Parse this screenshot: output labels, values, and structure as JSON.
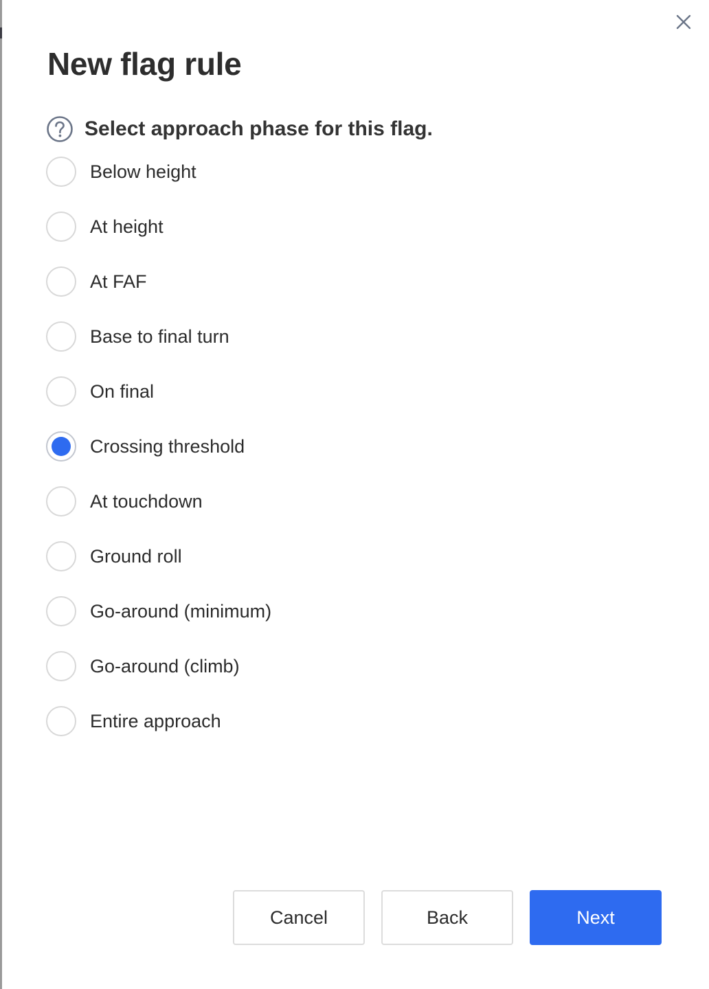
{
  "dialog": {
    "title": "New flag rule",
    "question": "Select approach phase for this flag.",
    "close_icon": "close-icon",
    "help_icon": "question-circle-icon"
  },
  "options": [
    {
      "label": "Below height",
      "checked": false
    },
    {
      "label": "At height",
      "checked": false
    },
    {
      "label": "At FAF",
      "checked": false
    },
    {
      "label": "Base to final turn",
      "checked": false
    },
    {
      "label": "On final",
      "checked": false
    },
    {
      "label": "Crossing threshold",
      "checked": true
    },
    {
      "label": "At touchdown",
      "checked": false
    },
    {
      "label": "Ground roll",
      "checked": false
    },
    {
      "label": "Go-around (minimum)",
      "checked": false
    },
    {
      "label": "Go-around (climb)",
      "checked": false
    },
    {
      "label": "Entire approach",
      "checked": false
    }
  ],
  "buttons": {
    "cancel": "Cancel",
    "back": "Back",
    "next": "Next"
  },
  "colors": {
    "accent": "#2e6bf0",
    "text": "#2b2b2b",
    "border": "#d8d8d8"
  }
}
